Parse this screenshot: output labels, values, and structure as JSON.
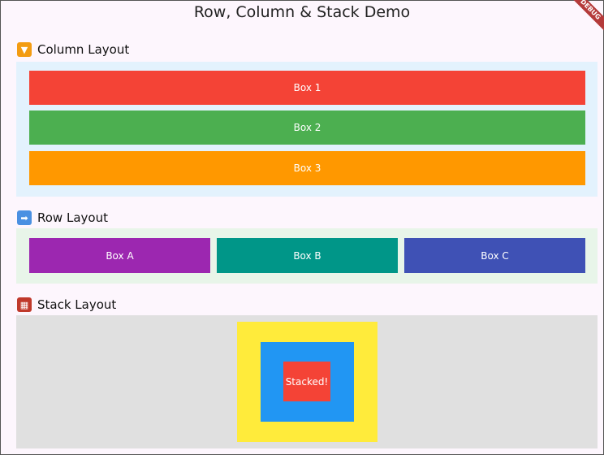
{
  "app": {
    "title": "Row, Column & Stack Demo",
    "debug_banner": "DEBUG"
  },
  "column": {
    "label": "Column Layout",
    "icon": "down-arrow-icon",
    "boxes": [
      "Box 1",
      "Box 2",
      "Box 3"
    ],
    "colors": [
      "#f44336",
      "#4caf50",
      "#ff9800"
    ]
  },
  "row": {
    "label": "Row Layout",
    "icon": "right-arrow-icon",
    "boxes": [
      "Box A",
      "Box B",
      "Box C"
    ],
    "colors": [
      "#9c27b0",
      "#009688",
      "#3f51b5"
    ]
  },
  "stack": {
    "label": "Stack Layout",
    "icon": "brick-icon",
    "label_text": "Stacked!",
    "colors": [
      "#ffeb3b",
      "#2196f3",
      "#f44336"
    ]
  }
}
